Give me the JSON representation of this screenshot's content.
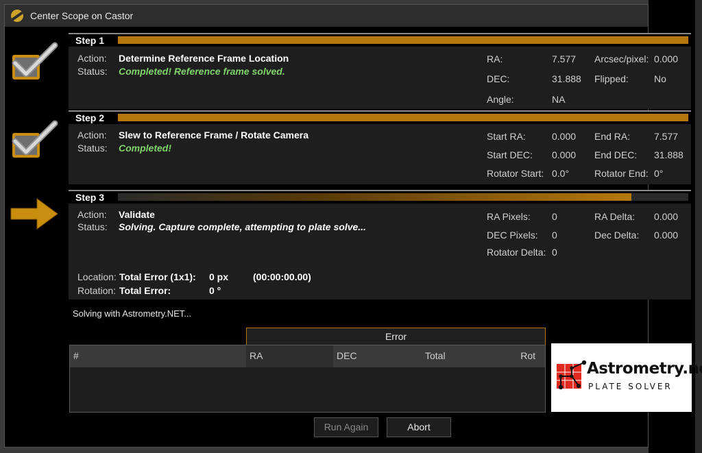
{
  "window": {
    "title": "Center Scope on Castor"
  },
  "steps": [
    {
      "label": "Step 1",
      "progress": 1.0,
      "action_label": "Action:",
      "action": "Determine Reference Frame Location",
      "status_label": "Status:",
      "status": "Completed!  Reference frame solved.",
      "fields": [
        {
          "k": "RA:",
          "v": "7.577"
        },
        {
          "k": "Arcsec/pixel:",
          "v": "0.000"
        },
        {
          "k": "DEC:",
          "v": "31.888"
        },
        {
          "k": "Flipped:",
          "v": "No"
        },
        {
          "k": "Angle:",
          "v": "NA"
        }
      ]
    },
    {
      "label": "Step 2",
      "progress": 1.0,
      "action_label": "Action:",
      "action": "Slew to Reference Frame / Rotate Camera",
      "status_label": "Status:",
      "status": "Completed!",
      "fields": [
        {
          "k": "Start RA:",
          "v": "0.000"
        },
        {
          "k": "End RA:",
          "v": "7.577"
        },
        {
          "k": "Start DEC:",
          "v": "0.000"
        },
        {
          "k": "End DEC:",
          "v": "31.888"
        },
        {
          "k": "Rotator Start:",
          "v": "0.0°"
        },
        {
          "k": "Rotator End:",
          "v": "0°"
        }
      ]
    },
    {
      "label": "Step 3",
      "progress": 0.9,
      "action_label": "Action:",
      "action": "Validate",
      "status_label": "Status:",
      "status": "Solving.  Capture complete, attempting to plate solve...",
      "fields": [
        {
          "k": "RA Pixels:",
          "v": "0"
        },
        {
          "k": "RA Delta:",
          "v": "0.000"
        },
        {
          "k": "DEC Pixels:",
          "v": "0"
        },
        {
          "k": "Dec Delta:",
          "v": "0.000"
        },
        {
          "k": "Rotator Delta:",
          "v": "0"
        }
      ],
      "location_label": "Location:",
      "location_title": "Total Error (1x1):",
      "location_value": "0 px",
      "location_time": "(00:00:00.00)",
      "rotation_label": "Rotation:",
      "rotation_title": "Total Error:",
      "rotation_value": "0 °"
    }
  ],
  "solve_message": "Solving with Astrometry.NET...",
  "grid": {
    "group_header": "Error",
    "columns": [
      "#",
      "RA",
      "DEC",
      "Total",
      "Rot"
    ],
    "rows": []
  },
  "logo": {
    "name": "Astrometry.net",
    "tagline": "PLATE SOLVER"
  },
  "buttons": {
    "run_again": "Run Again",
    "abort": "Abort"
  },
  "icons": {
    "step1": "checkmark-icon",
    "step2": "checkmark-icon",
    "step3": "arrow-right-icon"
  },
  "colors": {
    "accent": "#b5780c",
    "success": "#7fd36b"
  }
}
